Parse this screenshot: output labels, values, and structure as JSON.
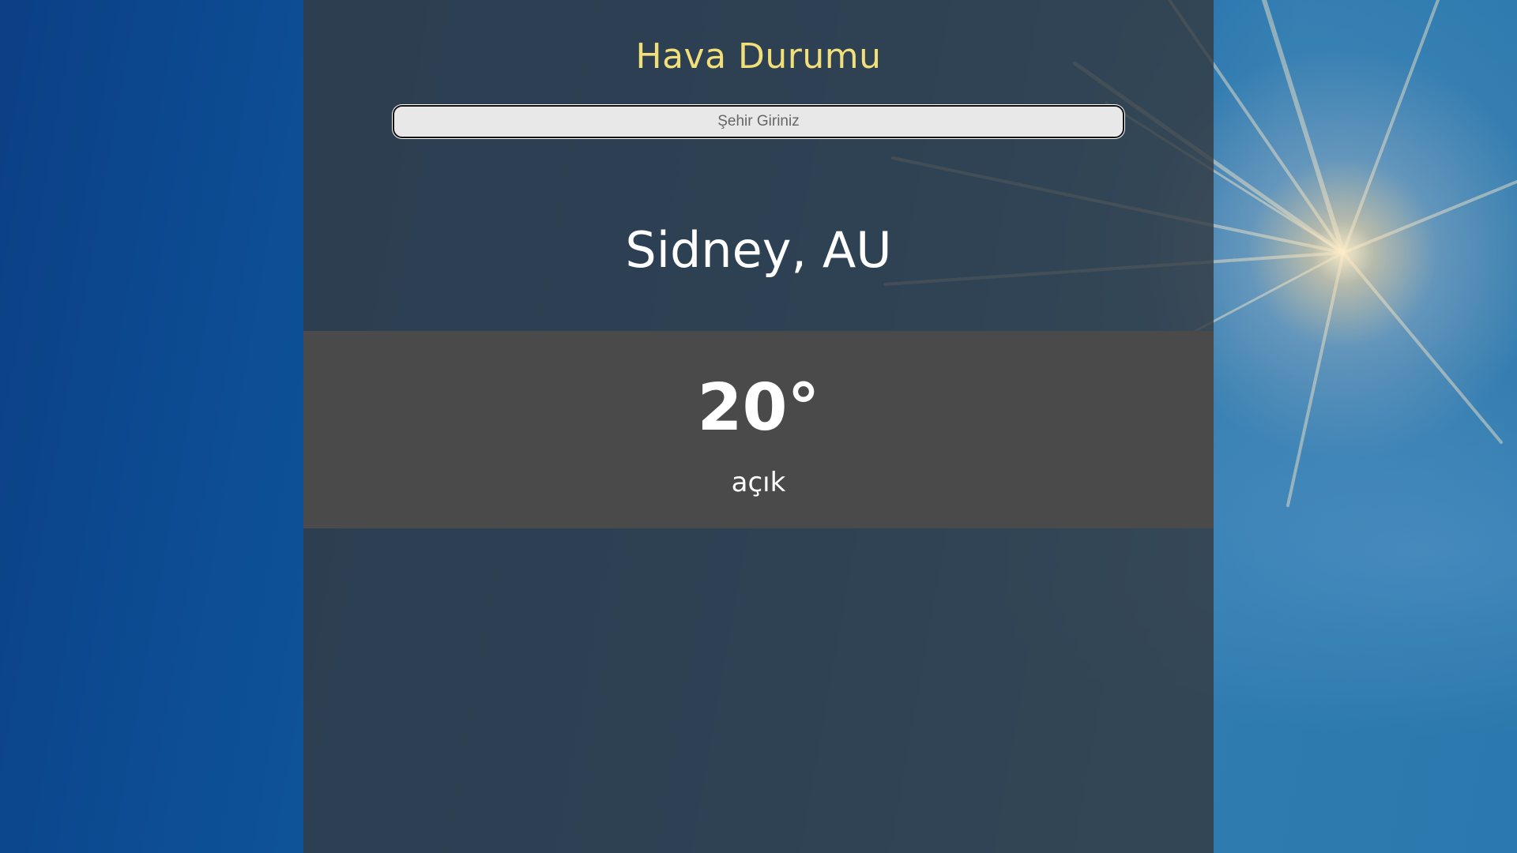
{
  "header": {
    "title": "Hava Durumu"
  },
  "search": {
    "placeholder": "Şehir Giriniz",
    "value": ""
  },
  "weather": {
    "location": "Sidney, AU",
    "temperature": "20°",
    "description": "açık"
  },
  "colors": {
    "title": "#f3df79",
    "panel": "#343a42",
    "temp_box": "#4a4a4a",
    "text": "#ffffff"
  }
}
